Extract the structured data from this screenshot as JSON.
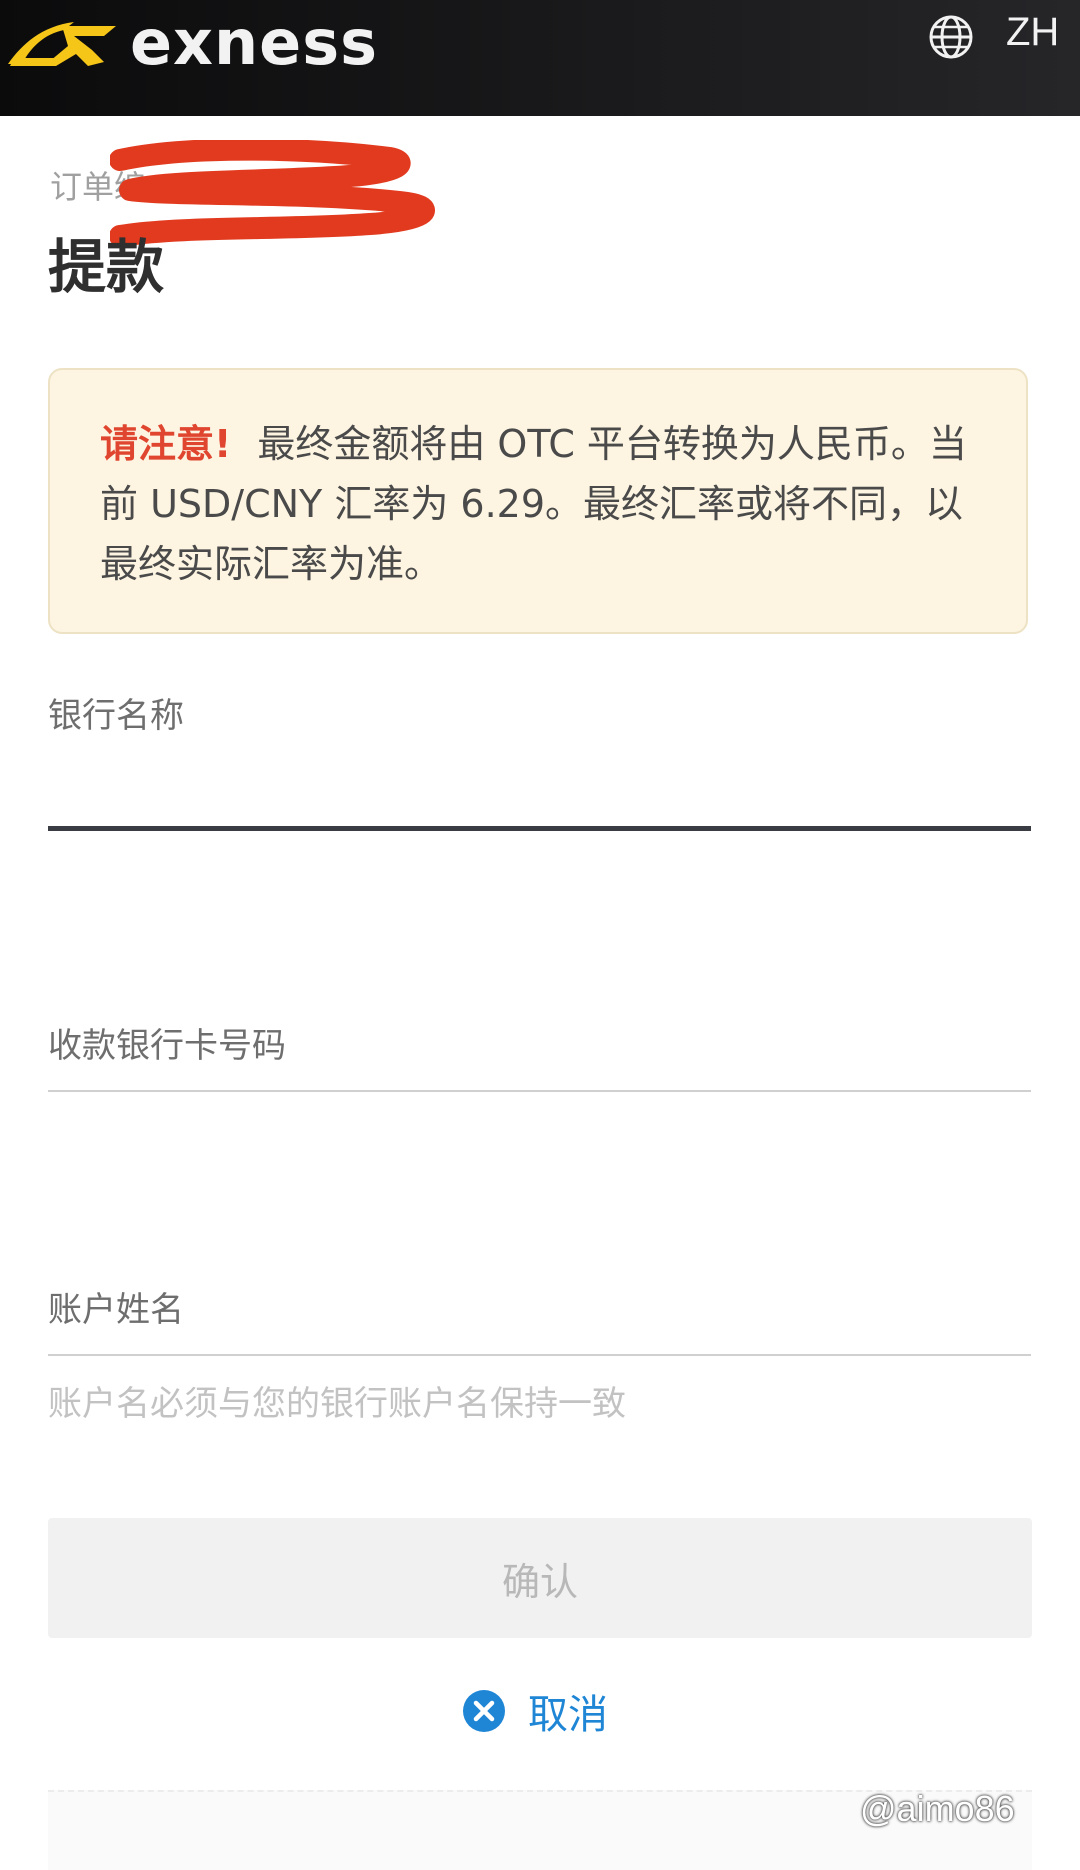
{
  "header": {
    "logo_text": "exness",
    "language": "ZH",
    "brand_color": "#f5c518"
  },
  "order": {
    "label": "订单编"
  },
  "page_title": "提款",
  "notice": {
    "attention": "请注意!",
    "message": "最终金额将由 OTC 平台转换为人民币。当前 USD/CNY 汇率为 6.29。最终汇率或将不同，以最终实际汇率为准。"
  },
  "form": {
    "bank_name": {
      "label": "银行名称",
      "value": ""
    },
    "card_number": {
      "label": "收款银行卡号码",
      "value": ""
    },
    "account_name": {
      "label": "账户姓名",
      "value": "",
      "hint": "账户名必须与您的银行账户名保持一致"
    },
    "confirm_label": "确认",
    "cancel_label": "取消"
  },
  "watermark": "@aimo86"
}
